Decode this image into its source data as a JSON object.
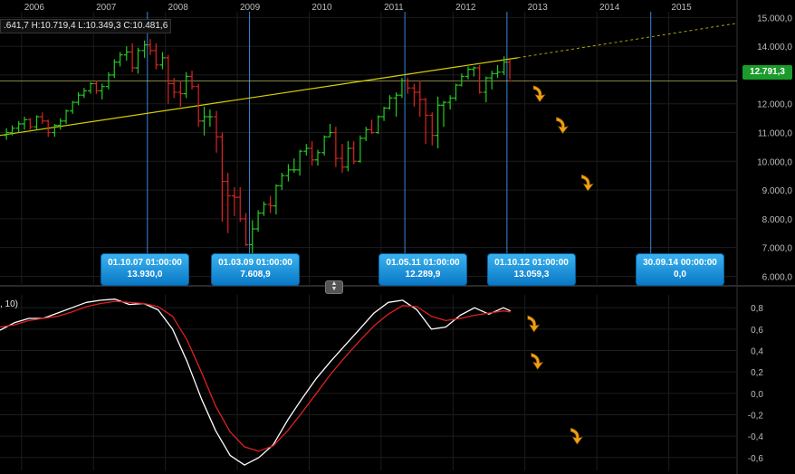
{
  "ohlc_readout": ".641,7  H:10.719,4  L:10.349,3  C:10.481,6",
  "indicator_label": ", 10)",
  "last_price_badge": "12.791,3",
  "callouts": [
    {
      "date": "01.10.07 01:00:00",
      "value": "13.930,0"
    },
    {
      "date": "01.03.09 01:00:00",
      "value": "7.608,9"
    },
    {
      "date": "01.05.11 01:00:00",
      "value": "12.289,9"
    },
    {
      "date": "01.10.12 01:00:00",
      "value": "13.059,3"
    },
    {
      "date": "30.09.14 00:00:00",
      "value": "0,0"
    }
  ],
  "splitter_icon": "up-down-arrows-icon",
  "colors": {
    "up_bar": "#22cc22",
    "down_bar": "#dd2222",
    "trendline": "#d8d000",
    "vline": "#3a86d8",
    "oscillator_main": "#ffffff",
    "oscillator_signal": "#dd2020",
    "forecast_arrow": "#f0a010",
    "price_badge": "#1a9b2a"
  },
  "chart_data": [
    {
      "type": "ohlc",
      "x_axis_ticks": [
        "2006",
        "2007",
        "2008",
        "2009",
        "2010",
        "2011",
        "2012",
        "2013",
        "2014",
        "2015"
      ],
      "y_axis_ticks": [
        "15.000,0",
        "14.000,0",
        "13.000,0",
        "12.000,0",
        "11.000,0",
        "10.000,0",
        "9.000,0",
        "8.000,0",
        "7.000,0",
        "6.000,0"
      ],
      "ylim": [
        5700,
        15200
      ],
      "xlim": [
        2005.7,
        2015.95
      ],
      "last_price": 12791.3,
      "vertical_markers": [
        2007.75,
        2009.17,
        2011.33,
        2012.75,
        2014.75
      ],
      "trendline": {
        "x": [
          2005.7,
          2012.9
        ],
        "y": [
          10900,
          13600
        ],
        "extension_to": [
          2015.95,
          14800
        ]
      },
      "bars": [
        {
          "t": 2005.79,
          "o": 10900,
          "h": 11150,
          "l": 10750,
          "c": 11000
        },
        {
          "t": 2005.87,
          "o": 11000,
          "h": 11250,
          "l": 10900,
          "c": 11150
        },
        {
          "t": 2005.96,
          "o": 11150,
          "h": 11400,
          "l": 11000,
          "c": 11300
        },
        {
          "t": 2006.04,
          "o": 11300,
          "h": 11550,
          "l": 11100,
          "c": 11450
        },
        {
          "t": 2006.12,
          "o": 11450,
          "h": 11500,
          "l": 11100,
          "c": 11200
        },
        {
          "t": 2006.21,
          "o": 11200,
          "h": 11600,
          "l": 11100,
          "c": 11550
        },
        {
          "t": 2006.29,
          "o": 11550,
          "h": 11700,
          "l": 11300,
          "c": 11400
        },
        {
          "t": 2006.37,
          "o": 11400,
          "h": 11450,
          "l": 10850,
          "c": 11000
        },
        {
          "t": 2006.46,
          "o": 11000,
          "h": 11300,
          "l": 10850,
          "c": 11250
        },
        {
          "t": 2006.54,
          "o": 11250,
          "h": 11500,
          "l": 11100,
          "c": 11400
        },
        {
          "t": 2006.62,
          "o": 11400,
          "h": 11800,
          "l": 11300,
          "c": 11750
        },
        {
          "t": 2006.71,
          "o": 11750,
          "h": 12100,
          "l": 11650,
          "c": 12050
        },
        {
          "t": 2006.79,
          "o": 12050,
          "h": 12400,
          "l": 11950,
          "c": 12300
        },
        {
          "t": 2006.87,
          "o": 12300,
          "h": 12550,
          "l": 12200,
          "c": 12450
        },
        {
          "t": 2006.96,
          "o": 12450,
          "h": 12750,
          "l": 12350,
          "c": 12700
        },
        {
          "t": 2007.04,
          "o": 12700,
          "h": 12800,
          "l": 12350,
          "c": 12450
        },
        {
          "t": 2007.12,
          "o": 12450,
          "h": 12700,
          "l": 12150,
          "c": 12600
        },
        {
          "t": 2007.21,
          "o": 12600,
          "h": 13100,
          "l": 12500,
          "c": 13000
        },
        {
          "t": 2007.29,
          "o": 13000,
          "h": 13550,
          "l": 12900,
          "c": 13450
        },
        {
          "t": 2007.37,
          "o": 13450,
          "h": 13800,
          "l": 13300,
          "c": 13700
        },
        {
          "t": 2007.46,
          "o": 13700,
          "h": 14000,
          "l": 13500,
          "c": 13800
        },
        {
          "t": 2007.54,
          "o": 13800,
          "h": 14100,
          "l": 13100,
          "c": 13250
        },
        {
          "t": 2007.62,
          "o": 13250,
          "h": 13950,
          "l": 13050,
          "c": 13850
        },
        {
          "t": 2007.71,
          "o": 13850,
          "h": 14200,
          "l": 13600,
          "c": 14050
        },
        {
          "t": 2007.79,
          "o": 14050,
          "h": 14250,
          "l": 13700,
          "c": 13850
        },
        {
          "t": 2007.87,
          "o": 13850,
          "h": 14100,
          "l": 13200,
          "c": 13350
        },
        {
          "t": 2007.96,
          "o": 13350,
          "h": 13800,
          "l": 13200,
          "c": 13600
        },
        {
          "t": 2008.04,
          "o": 13600,
          "h": 13700,
          "l": 12000,
          "c": 12700
        },
        {
          "t": 2008.12,
          "o": 12700,
          "h": 12900,
          "l": 12200,
          "c": 12400
        },
        {
          "t": 2008.21,
          "o": 12400,
          "h": 12800,
          "l": 11900,
          "c": 12350
        },
        {
          "t": 2008.29,
          "o": 12350,
          "h": 13100,
          "l": 12200,
          "c": 12950
        },
        {
          "t": 2008.37,
          "o": 12950,
          "h": 13150,
          "l": 12500,
          "c": 12600
        },
        {
          "t": 2008.46,
          "o": 12600,
          "h": 12700,
          "l": 11200,
          "c": 11400
        },
        {
          "t": 2008.54,
          "o": 11400,
          "h": 11900,
          "l": 10900,
          "c": 11550
        },
        {
          "t": 2008.62,
          "o": 11550,
          "h": 11800,
          "l": 11200,
          "c": 11550
        },
        {
          "t": 2008.71,
          "o": 11550,
          "h": 11750,
          "l": 10300,
          "c": 10850
        },
        {
          "t": 2008.79,
          "o": 10850,
          "h": 11000,
          "l": 7900,
          "c": 9300
        },
        {
          "t": 2008.87,
          "o": 9300,
          "h": 9600,
          "l": 7500,
          "c": 8800
        },
        {
          "t": 2008.96,
          "o": 8800,
          "h": 9100,
          "l": 8100,
          "c": 8750
        },
        {
          "t": 2009.04,
          "o": 8750,
          "h": 9100,
          "l": 7900,
          "c": 8000
        },
        {
          "t": 2009.12,
          "o": 8000,
          "h": 8200,
          "l": 7050,
          "c": 7100
        },
        {
          "t": 2009.21,
          "o": 7100,
          "h": 7950,
          "l": 6650,
          "c": 7650
        },
        {
          "t": 2009.29,
          "o": 7650,
          "h": 8300,
          "l": 7550,
          "c": 8200
        },
        {
          "t": 2009.37,
          "o": 8200,
          "h": 8600,
          "l": 8100,
          "c": 8500
        },
        {
          "t": 2009.46,
          "o": 8500,
          "h": 8800,
          "l": 8200,
          "c": 8450
        },
        {
          "t": 2009.54,
          "o": 8450,
          "h": 9200,
          "l": 8150,
          "c": 9150
        },
        {
          "t": 2009.62,
          "o": 9150,
          "h": 9600,
          "l": 9000,
          "c": 9500
        },
        {
          "t": 2009.71,
          "o": 9500,
          "h": 9900,
          "l": 9300,
          "c": 9700
        },
        {
          "t": 2009.79,
          "o": 9700,
          "h": 10100,
          "l": 9600,
          "c": 9700
        },
        {
          "t": 2009.87,
          "o": 9700,
          "h": 10400,
          "l": 9500,
          "c": 10350
        },
        {
          "t": 2009.96,
          "o": 10350,
          "h": 10600,
          "l": 10200,
          "c": 10450
        },
        {
          "t": 2010.04,
          "o": 10450,
          "h": 10700,
          "l": 9850,
          "c": 10050
        },
        {
          "t": 2010.12,
          "o": 10050,
          "h": 10400,
          "l": 9850,
          "c": 10300
        },
        {
          "t": 2010.21,
          "o": 10300,
          "h": 10900,
          "l": 10200,
          "c": 10850
        },
        {
          "t": 2010.29,
          "o": 10850,
          "h": 11300,
          "l": 10850,
          "c": 11000
        },
        {
          "t": 2010.37,
          "o": 11000,
          "h": 11200,
          "l": 9800,
          "c": 10100
        },
        {
          "t": 2010.46,
          "o": 10100,
          "h": 10600,
          "l": 9600,
          "c": 9800
        },
        {
          "t": 2010.54,
          "o": 9800,
          "h": 10700,
          "l": 9650,
          "c": 10450
        },
        {
          "t": 2010.62,
          "o": 10450,
          "h": 10700,
          "l": 9900,
          "c": 10000
        },
        {
          "t": 2010.71,
          "o": 10000,
          "h": 10900,
          "l": 9950,
          "c": 10800
        },
        {
          "t": 2010.79,
          "o": 10800,
          "h": 11200,
          "l": 10700,
          "c": 11100
        },
        {
          "t": 2010.87,
          "o": 11100,
          "h": 11450,
          "l": 10950,
          "c": 11000
        },
        {
          "t": 2010.96,
          "o": 11000,
          "h": 11600,
          "l": 10950,
          "c": 11550
        },
        {
          "t": 2011.04,
          "o": 11550,
          "h": 11900,
          "l": 11400,
          "c": 11850
        },
        {
          "t": 2011.12,
          "o": 11850,
          "h": 12300,
          "l": 11800,
          "c": 12200
        },
        {
          "t": 2011.21,
          "o": 12200,
          "h": 12400,
          "l": 11550,
          "c": 12300
        },
        {
          "t": 2011.29,
          "o": 12300,
          "h": 12900,
          "l": 12200,
          "c": 12800
        },
        {
          "t": 2011.37,
          "o": 12800,
          "h": 12900,
          "l": 12350,
          "c": 12550
        },
        {
          "t": 2011.46,
          "o": 12550,
          "h": 12700,
          "l": 11900,
          "c": 12400
        },
        {
          "t": 2011.54,
          "o": 12400,
          "h": 12800,
          "l": 11550,
          "c": 12150
        },
        {
          "t": 2011.62,
          "o": 12150,
          "h": 12200,
          "l": 10600,
          "c": 11600
        },
        {
          "t": 2011.71,
          "o": 11600,
          "h": 11700,
          "l": 10550,
          "c": 10900
        },
        {
          "t": 2011.79,
          "o": 10900,
          "h": 12250,
          "l": 10450,
          "c": 11950
        },
        {
          "t": 2011.87,
          "o": 11950,
          "h": 12100,
          "l": 11200,
          "c": 12050
        },
        {
          "t": 2011.96,
          "o": 12050,
          "h": 12300,
          "l": 11800,
          "c": 12200
        },
        {
          "t": 2012.04,
          "o": 12200,
          "h": 12700,
          "l": 12100,
          "c": 12650
        },
        {
          "t": 2012.12,
          "o": 12650,
          "h": 13050,
          "l": 12600,
          "c": 12950
        },
        {
          "t": 2012.21,
          "o": 12950,
          "h": 13300,
          "l": 12850,
          "c": 13200
        },
        {
          "t": 2012.29,
          "o": 13200,
          "h": 13300,
          "l": 12950,
          "c": 13250
        },
        {
          "t": 2012.37,
          "o": 13250,
          "h": 13350,
          "l": 12350,
          "c": 12400
        },
        {
          "t": 2012.46,
          "o": 12400,
          "h": 12950,
          "l": 12050,
          "c": 12900
        },
        {
          "t": 2012.54,
          "o": 12900,
          "h": 13150,
          "l": 12500,
          "c": 13050
        },
        {
          "t": 2012.62,
          "o": 13050,
          "h": 13350,
          "l": 12900,
          "c": 13100
        },
        {
          "t": 2012.71,
          "o": 13100,
          "h": 13650,
          "l": 13000,
          "c": 13450
        },
        {
          "t": 2012.79,
          "o": 13450,
          "h": 13550,
          "l": 12850,
          "c": 12800
        }
      ],
      "forecast_arrows": [
        {
          "t": 2013.18,
          "y": 12350
        },
        {
          "t": 2013.5,
          "y": 11250
        },
        {
          "t": 2013.85,
          "y": 9250
        }
      ]
    },
    {
      "type": "line",
      "y_axis_ticks": [
        "0,8",
        "0,6",
        "0,4",
        "0,2",
        "0,0",
        "-0,2",
        "-0,4",
        "-0,6"
      ],
      "ylim": [
        -0.72,
        0.92
      ],
      "series": [
        {
          "x": [
            2005.7,
            2005.9,
            2006.1,
            2006.3,
            2006.5,
            2006.7,
            2006.9,
            2007.1,
            2007.3,
            2007.5,
            2007.7,
            2007.9,
            2008.1,
            2008.3,
            2008.5,
            2008.7,
            2008.9,
            2009.1,
            2009.3,
            2009.5,
            2009.7,
            2009.9,
            2010.1,
            2010.3,
            2010.5,
            2010.7,
            2010.9,
            2011.1,
            2011.3,
            2011.5,
            2011.7,
            2011.9,
            2012.1,
            2012.3,
            2012.5,
            2012.7,
            2012.8
          ],
          "y": [
            0.59,
            0.66,
            0.7,
            0.7,
            0.75,
            0.8,
            0.85,
            0.87,
            0.88,
            0.83,
            0.84,
            0.78,
            0.6,
            0.3,
            -0.05,
            -0.35,
            -0.58,
            -0.67,
            -0.6,
            -0.48,
            -0.25,
            -0.05,
            0.14,
            0.3,
            0.45,
            0.6,
            0.75,
            0.85,
            0.87,
            0.78,
            0.6,
            0.62,
            0.73,
            0.8,
            0.74,
            0.8,
            0.77
          ]
        },
        {
          "x": [
            2005.7,
            2005.9,
            2006.1,
            2006.3,
            2006.5,
            2006.7,
            2006.9,
            2007.1,
            2007.3,
            2007.5,
            2007.7,
            2007.9,
            2008.1,
            2008.3,
            2008.5,
            2008.7,
            2008.9,
            2009.1,
            2009.3,
            2009.5,
            2009.7,
            2009.9,
            2010.1,
            2010.3,
            2010.5,
            2010.7,
            2010.9,
            2011.1,
            2011.3,
            2011.5,
            2011.7,
            2011.9,
            2012.1,
            2012.3,
            2012.5,
            2012.7,
            2012.8
          ],
          "y": [
            0.62,
            0.64,
            0.68,
            0.7,
            0.72,
            0.76,
            0.81,
            0.84,
            0.86,
            0.85,
            0.84,
            0.81,
            0.72,
            0.5,
            0.2,
            -0.12,
            -0.36,
            -0.5,
            -0.54,
            -0.49,
            -0.35,
            -0.18,
            0.0,
            0.18,
            0.34,
            0.49,
            0.63,
            0.74,
            0.82,
            0.81,
            0.72,
            0.68,
            0.7,
            0.73,
            0.75,
            0.77,
            0.76
          ]
        }
      ],
      "forecast_arrows": [
        {
          "t": 2013.1,
          "y": 0.65
        },
        {
          "t": 2013.15,
          "y": 0.3
        },
        {
          "t": 2013.7,
          "y": -0.4
        }
      ]
    }
  ]
}
